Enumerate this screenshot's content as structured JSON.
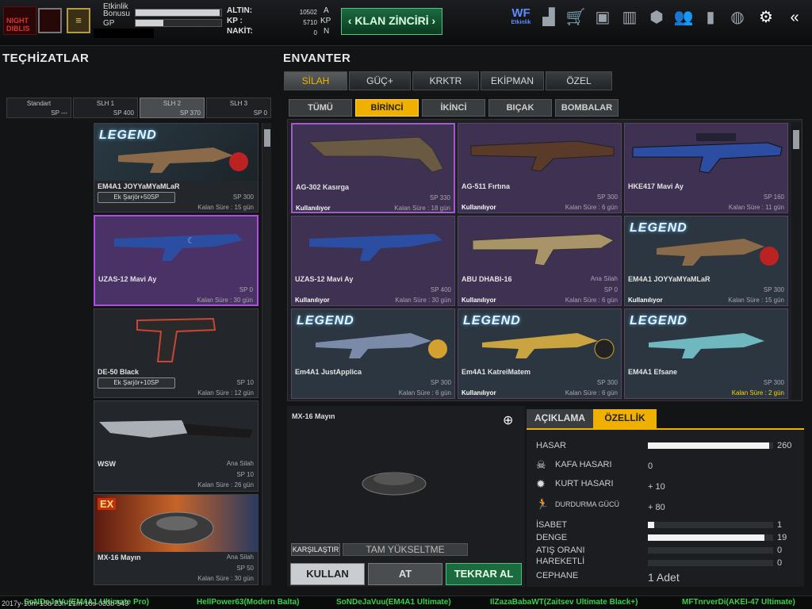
{
  "header": {
    "logo_text": "NIGHT DIBLIS",
    "rank_symbol": "≡",
    "progress": [
      {
        "label": "Etkinlik Bonusu",
        "fill": 0.98
      },
      {
        "label": "GP",
        "fill": 0.32
      }
    ],
    "currency": [
      {
        "name": "ALTIN:",
        "value": "10502",
        "unit": "A"
      },
      {
        "name": "KP :",
        "value": "5710",
        "unit": "KP"
      },
      {
        "name": "NAKİT:",
        "value": "0",
        "unit": "N"
      }
    ],
    "klan_button": "KLAN ZİNCİRİ",
    "etkinlik": "Etkinlik",
    "wf": "WF"
  },
  "left": {
    "title": "TEÇHİZATLAR",
    "loadouts": [
      {
        "name": "Standart",
        "sp": "SP ---"
      },
      {
        "name": "SLH 1",
        "sp": "SP 400"
      },
      {
        "name": "SLH 2",
        "sp": "SP 370"
      },
      {
        "name": "SLH 3",
        "sp": "SP 0"
      }
    ],
    "cards": [
      {
        "name": "EM4A1 JOYYaMYaMLaR",
        "button": "Ek Şarjör+50SP",
        "sp": "SP 300",
        "time": "Kalan Süre : 15 gün"
      },
      {
        "name": "UZAS-12 Mavi Ay",
        "sp": "SP 0",
        "time": "Kalan Süre : 30 gün"
      },
      {
        "name": "DE-50 Black",
        "button": "Ek Şarjör+10SP",
        "sp": "SP 10",
        "time": "Kalan Süre : 12 gün"
      },
      {
        "name": "WSW",
        "sp_label": "Ana Silah",
        "sp": "SP 10",
        "time": "Kalan Süre : 26 gün"
      },
      {
        "name": "MX-16 Mayın",
        "sp_label": "Ana Silah",
        "sp": "SP 50",
        "time": "Kalan Süre : 30 gün"
      }
    ]
  },
  "inventory": {
    "title": "ENVANTER",
    "tabs": [
      "SİLAH",
      "GÜÇ+",
      "KRKTR",
      "EKİPMAN",
      "ÖZEL"
    ],
    "subtabs": [
      "TÜMÜ",
      "BİRİNCİ",
      "İKİNCİ",
      "BIÇAK",
      "BOMBALAR"
    ],
    "items": [
      {
        "name": "AG-302 Kasırga",
        "sp": "SP 330",
        "status": "Kullanılıyor",
        "time": "Kalan Süre : 18 gün"
      },
      {
        "name": "AG-511 Fırtına",
        "sp": "SP 300",
        "status": "Kullanılıyor",
        "time": "Kalan Süre : 6 gün"
      },
      {
        "name": "HKE417 Mavi Ay",
        "sp": "SP 160",
        "status": "",
        "time": "Kalan Süre : 11 gün"
      },
      {
        "name": "UZAS-12 Mavi Ay",
        "sp": "SP 400",
        "status": "Kullanılıyor",
        "time": "Kalan Süre : 30 gün"
      },
      {
        "name": "ABU DHABI-16",
        "sp": "Ana Silah",
        "sp2": "SP 0",
        "status": "Kullanılıyor",
        "time": "Kalan Süre : 6 gün"
      },
      {
        "name": "EM4A1 JOYYaMYaMLaR",
        "sp": "SP 300",
        "status": "Kullanılıyor",
        "time": "Kalan Süre : 15 gün"
      },
      {
        "name": "Em4A1 JustApplica",
        "sp": "SP 300",
        "status": "",
        "time": "Kalan Süre : 6 gün"
      },
      {
        "name": "Em4A1 KatreiMatem",
        "sp": "SP 300",
        "status": "Kullanılıyor",
        "time": "Kalan Süre : 6 gün"
      },
      {
        "name": "EM4A1 Efsane",
        "sp": "SP 300",
        "status": "",
        "time": "Kalan Süre : 2 gün"
      }
    ],
    "legend_text": "LEGEND"
  },
  "detail": {
    "item_name": "MX-16 Mayın",
    "compare": "KARŞILAŞTIR",
    "upgrade": "TAM YÜKSELTME",
    "use": "KULLAN",
    "drop": "AT",
    "rebuy": "TEKRAR AL"
  },
  "stats": {
    "tabs": [
      "AÇIKLAMA",
      "ÖZELLİK"
    ],
    "rows": [
      {
        "label": "HASAR",
        "value": "260",
        "bar": 0.97
      },
      {
        "label": "KAFA HASARI",
        "value": "0"
      },
      {
        "label": "KURT HASARI",
        "value": "+ 10"
      },
      {
        "label": "DURDURMA GÜCÜ",
        "value": "+ 80"
      },
      {
        "label": "İSABET",
        "value": "1",
        "bar": 0.05
      },
      {
        "label": "DENGE",
        "value": "19",
        "bar": 0.93
      },
      {
        "label": "ATIŞ ORANI",
        "value": "0",
        "bar": 0
      },
      {
        "label": "HAREKETLİ",
        "value": "0",
        "bar": 0
      },
      {
        "label": "CEPHANE",
        "value": "1 Adet"
      }
    ]
  },
  "ticker": [
    "SoNDeJaVu(EM4A1 Ultimate Pro)",
    "HellPower63(Modern Balta)",
    "SoNDeJaVuu(EM4A1 Ultimate)",
    "IlZazaBabaWT(Zaitsev Ultimate Black+)",
    "MFTnrverDi(AKEI-47 Ultimate)"
  ],
  "debug_text": "2017y-10m-15d-23h-21m-16s-033b-543"
}
